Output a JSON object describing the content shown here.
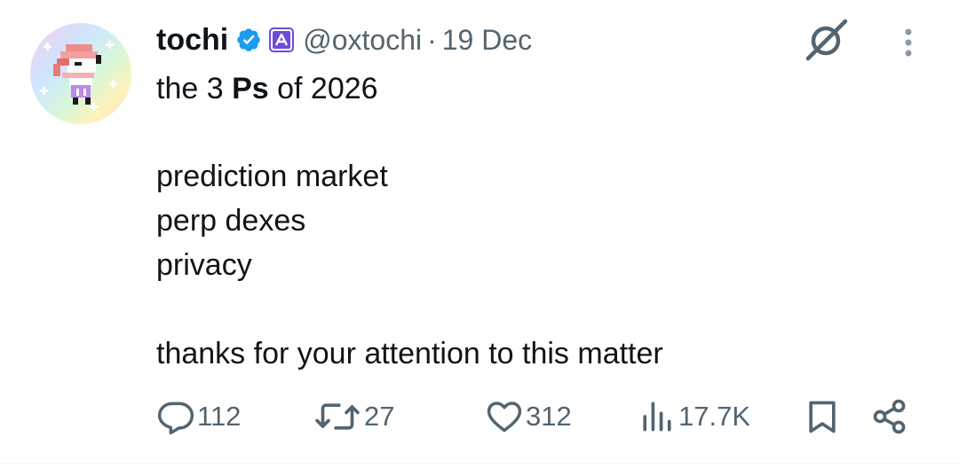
{
  "author": {
    "name": "tochi",
    "handle": "@oxtochi",
    "separator": "·",
    "date": "19 Dec"
  },
  "tweet": {
    "line1_pre": "the 3 ",
    "line1_bold": "Ps",
    "line1_post": " of 2026",
    "list": [
      "prediction market",
      "perp dexes",
      "privacy"
    ],
    "closing": "thanks for your attention to this matter"
  },
  "actions": {
    "replies": "112",
    "reposts": "27",
    "likes": "312",
    "views": "17.7K"
  },
  "icons": {
    "verified": "verified-badge-icon",
    "affiliate": "affiliate-badge-icon",
    "grok": "grok-icon",
    "more": "more-icon",
    "reply": "reply-icon",
    "repost": "repost-icon",
    "like": "heart-icon",
    "views": "views-icon",
    "bookmark": "bookmark-icon",
    "share": "share-icon"
  },
  "colors": {
    "text": "#0f1419",
    "muted": "#536471",
    "verified": "#1d9bf0",
    "affiliate": "#6d4cd9"
  }
}
